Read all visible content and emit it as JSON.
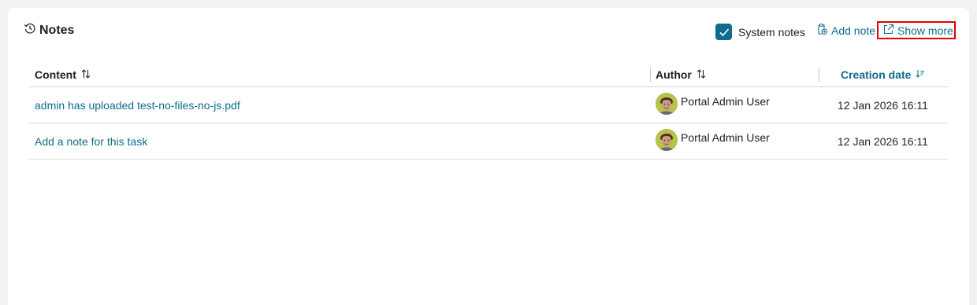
{
  "panel": {
    "title": "Notes",
    "system_notes_label": "System notes",
    "system_notes_checked": true,
    "add_note_label": "Add note",
    "show_more_label": "Show more"
  },
  "table": {
    "columns": {
      "content": "Content",
      "author": "Author",
      "creation_date": "Creation date"
    },
    "rows": [
      {
        "content": "admin has uploaded test-no-files-no-js.pdf",
        "author": "Portal Admin User",
        "date": "12 Jan 2026 16:11"
      },
      {
        "content": "Add a note for this task",
        "author": "Portal Admin User",
        "date": "12 Jan 2026 16:11"
      }
    ]
  },
  "colors": {
    "accent": "#0f6c8c",
    "highlight_border": "#e00000"
  },
  "icons": {
    "title": "history-icon",
    "add_note": "add-note-icon",
    "show_more": "open-in-new-icon",
    "sort": "sort-icon",
    "sort_desc": "sort-descending-icon"
  }
}
